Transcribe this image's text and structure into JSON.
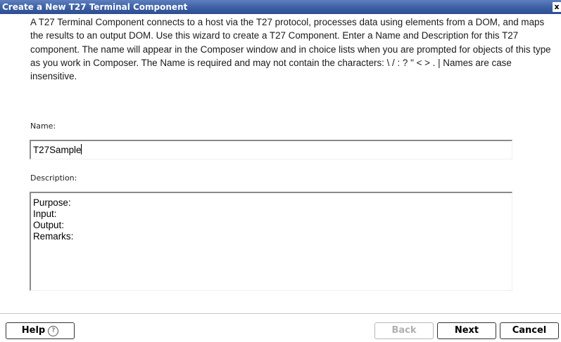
{
  "window": {
    "title": "Create a New T27 Terminal Component",
    "close_glyph": "x"
  },
  "intro": {
    "text": "A T27 Terminal Component connects to a host via the T27 protocol, processes data using elements from a DOM, and maps the results to an output DOM.  Use this wizard to create a T27 Component.  Enter a Name and Description for this T27 component.  The name will appear in the Composer window and in choice lists when you are prompted for objects of this type as you work in Composer.  The Name is required and may not contain the characters: \\ / : ? \" < > . |  Names are case insensitive."
  },
  "form": {
    "name_label": "Name:",
    "name_value": "T27Sample",
    "description_label": "Description:",
    "description_lines": [
      "Purpose:",
      "Input:",
      "Output:",
      "Remarks:"
    ]
  },
  "buttons": {
    "help": "Help",
    "help_icon": "?",
    "back": "Back",
    "next": "Next",
    "cancel": "Cancel"
  },
  "colors": {
    "titlebar": "#3d5fa3",
    "disabled_text": "#b0b0b0"
  }
}
